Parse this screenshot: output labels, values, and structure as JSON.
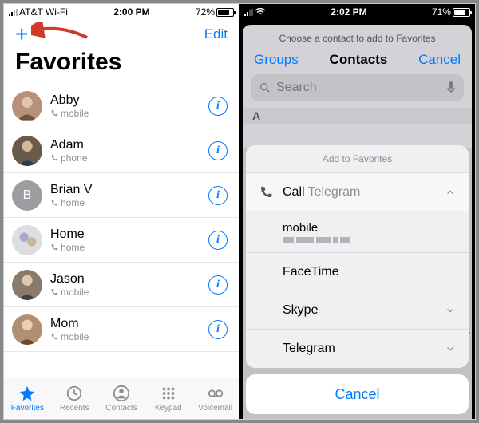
{
  "left": {
    "status": {
      "carrier": "AT&T Wi-Fi",
      "time": "2:00 PM",
      "battery": "72%"
    },
    "nav": {
      "add": "+",
      "edit": "Edit"
    },
    "title": "Favorites",
    "contacts": [
      {
        "name": "Abby",
        "type": "mobile"
      },
      {
        "name": "Adam",
        "type": "phone"
      },
      {
        "name": "Brian V",
        "type": "home",
        "initial": "B"
      },
      {
        "name": "Home",
        "type": "home"
      },
      {
        "name": "Jason",
        "type": "mobile"
      },
      {
        "name": "Mom",
        "type": "mobile"
      }
    ],
    "tabs": {
      "favorites": "Favorites",
      "recents": "Recents",
      "contacts": "Contacts",
      "keypad": "Keypad",
      "voicemail": "Voicemail"
    }
  },
  "right": {
    "status": {
      "time": "2:02 PM",
      "battery": "71%"
    },
    "header": "Choose a contact to add to Favorites",
    "nav": {
      "groups": "Groups",
      "title": "Contacts",
      "cancel": "Cancel"
    },
    "search_placeholder": "Search",
    "section": "A",
    "sheet": {
      "title": "Add to Favorites",
      "call": "Call",
      "call_sub": "Telegram",
      "options": {
        "mobile": "mobile",
        "facetime": "FaceTime",
        "skype": "Skype",
        "telegram": "Telegram"
      },
      "cancel": "Cancel"
    }
  }
}
